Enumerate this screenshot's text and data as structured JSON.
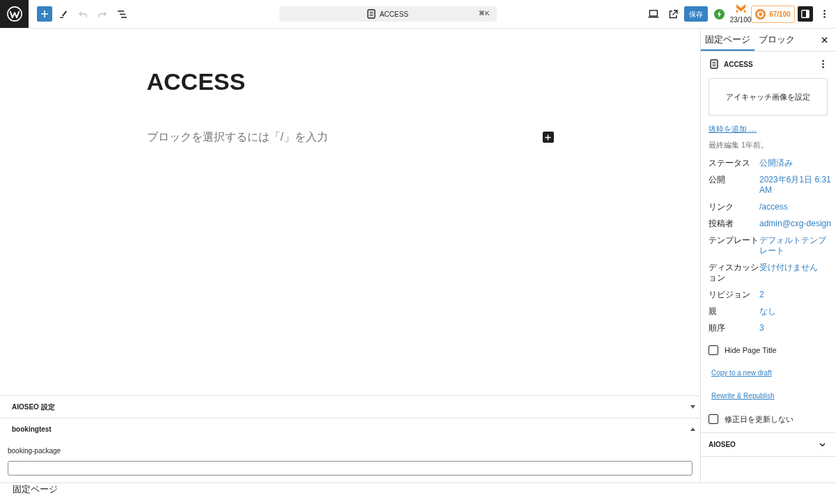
{
  "top_bar": {
    "tools": [
      {
        "kind": "inserter",
        "disabled": false
      },
      {
        "kind": "tools",
        "disabled": false
      },
      {
        "kind": "undo",
        "disabled": true
      },
      {
        "kind": "redo",
        "disabled": true
      },
      {
        "kind": "list_view",
        "disabled": false
      }
    ],
    "command_bar": {
      "title": "ACCESS",
      "shortcut": "⌘K"
    },
    "save_button": "保存",
    "readability_score": "23/100",
    "seo_score": "67/100",
    "settings_toggle_on": true
  },
  "editor": {
    "title": "ACCESS",
    "placeholder": "ブロックを選択するには「/」を入力"
  },
  "meta_boxes": [
    {
      "title": "AIOSEO 設定",
      "expanded": false
    },
    {
      "title": "bookingtest",
      "expanded": true,
      "fields": [
        {
          "label": "booking-package"
        }
      ]
    }
  ],
  "sidebar": {
    "tabs": [
      {
        "label": "固定ページ",
        "selected": true
      },
      {
        "label": "ブロック",
        "selected": false
      }
    ],
    "document_title": "ACCESS",
    "featured_image_button": "アイキャッチ画像を設定",
    "excerpt_link": "抜粋を追加 …",
    "last_edited": "最終編集 1年前。",
    "summary": [
      {
        "label": "ステータス",
        "value": "公開済み"
      },
      {
        "label": "公開",
        "value": "2023年6月1日 6:31 AM"
      },
      {
        "label": "リンク",
        "value": "/access"
      },
      {
        "label": "投稿者",
        "value": "admin@cxg-design"
      },
      {
        "label": "テンプレート",
        "value": "デフォルトテンプレート"
      },
      {
        "label": "ディスカッション",
        "value": "受け付けません"
      },
      {
        "label": "リビジョン",
        "value": "2"
      },
      {
        "label": "親",
        "value": "なし"
      },
      {
        "label": "順序",
        "value": "3"
      }
    ],
    "options": [
      {
        "kind": "checkbox",
        "label": "Hide Page Title",
        "checked": false
      },
      {
        "kind": "link",
        "label": "Copy to a new draft"
      },
      {
        "kind": "link",
        "label": "Rewrite & Republish"
      },
      {
        "kind": "checkbox",
        "label": "修正日を更新しない",
        "checked": false
      }
    ],
    "panels": [
      {
        "title": "AIOSEO",
        "expanded": false
      }
    ]
  },
  "status_bar": {
    "breadcrumb": "固定ページ"
  }
}
